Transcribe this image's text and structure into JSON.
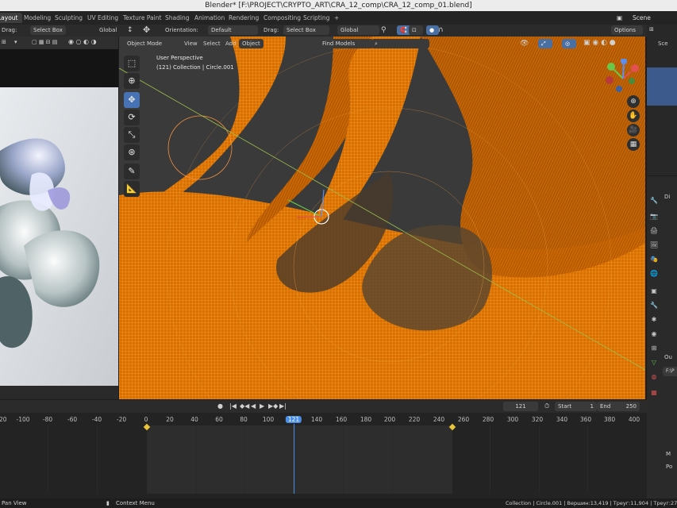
{
  "window_title": "Blender* [F:\\PROJECT\\CRYPTO_ART\\CRA_12_comp\\CRA_12_comp_01.blend]",
  "workspace_tabs": [
    {
      "label": "Layout",
      "active": true
    },
    {
      "label": "Modeling"
    },
    {
      "label": "Sculpting"
    },
    {
      "label": "UV Editing"
    },
    {
      "label": "Texture Paint"
    },
    {
      "label": "Shading"
    },
    {
      "label": "Animation"
    },
    {
      "label": "Rendering"
    },
    {
      "label": "Compositing"
    },
    {
      "label": "Scripting"
    }
  ],
  "add_workspace_icon": "+",
  "scene_label": "Scene",
  "header": {
    "left_drag_label": "Drag:",
    "left_select": "Select Box",
    "left_global": "Global",
    "orientation_label": "Orientation:",
    "orientation_value": "Default",
    "drag_label": "Drag:",
    "select_value": "Select Box",
    "transform_global": "Global",
    "options_label": "Options"
  },
  "viewport_menu": {
    "mode": "Object Mode",
    "view": "View",
    "select": "Select",
    "add": "Add",
    "object": "Object",
    "find_models": "Find Models"
  },
  "viewport_info": {
    "perspective": "User Perspective",
    "collection": "(121) Collection | Circle.001"
  },
  "timeline": {
    "current_frame": "121",
    "start_label": "Start",
    "start_value": "1",
    "end_label": "End",
    "end_value": "250",
    "ticks": [
      "-120",
      "-100",
      "-80",
      "-60",
      "-40",
      "-20",
      "0",
      "20",
      "40",
      "60",
      "80",
      "100",
      "121",
      "140",
      "160",
      "180",
      "200",
      "220",
      "240",
      "260",
      "280",
      "300",
      "320",
      "340",
      "360",
      "380",
      "400"
    ]
  },
  "properties": {
    "d_label": "Di",
    "o_label": "Ou",
    "path_prefix": "F:\\P",
    "m_label": "M",
    "p_label": "Po"
  },
  "status_bar": {
    "pan_view": "Pan View",
    "context_menu": "Context Menu",
    "stats": "Collection | Circle.001 | Вершин:13,419 | Треуг:11,904 | Треуг:27"
  },
  "colors": {
    "accent_blue": "#4772b3",
    "wire_orange": "#ff8a00",
    "viewport_bg": "#3a3a3a",
    "frame_marker": "#4b8fe6"
  }
}
